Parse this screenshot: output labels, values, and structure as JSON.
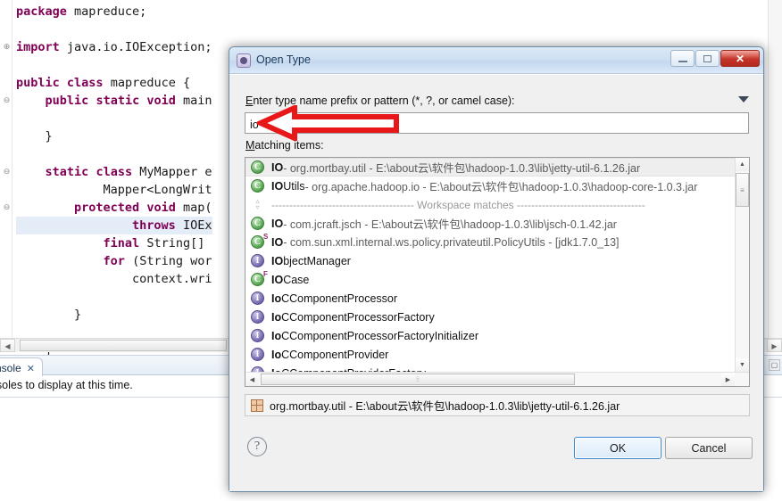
{
  "editor": {
    "lines": [
      {
        "fold": "",
        "html": "<span class=\"kw\">package</span> mapreduce;"
      },
      {
        "fold": "",
        "html": ""
      },
      {
        "fold": "+",
        "html": "<span class=\"kw\">import</span> java.io.IOException;"
      },
      {
        "fold": "",
        "html": ""
      },
      {
        "fold": "",
        "html": "<span class=\"kw\">public</span> <span class=\"kw\">class</span> mapreduce {"
      },
      {
        "fold": "-",
        "html": "    <span class=\"kw\">public</span> <span class=\"kw\">static</span> <span class=\"kw\">void</span> main"
      },
      {
        "fold": "",
        "html": ""
      },
      {
        "fold": "",
        "html": "    }"
      },
      {
        "fold": "",
        "html": ""
      },
      {
        "fold": "-",
        "html": "    <span class=\"kw\">static</span> <span class=\"kw\">class</span> MyMapper e"
      },
      {
        "fold": "",
        "html": "            Mapper&lt;LongWrit"
      },
      {
        "fold": "-",
        "html": "        <span class=\"kw\">protected</span> <span class=\"kw\">void</span> map("
      },
      {
        "fold": "",
        "html": "                <span class=\"kw\">throws</span> IOEx"
      },
      {
        "fold": "",
        "html": "            <span class=\"kw\">final</span> String[] "
      },
      {
        "fold": "",
        "html": "            <span class=\"kw\">for</span> (String wor"
      },
      {
        "fold": "",
        "html": "                context.wri"
      },
      {
        "fold": "",
        "html": ""
      },
      {
        "fold": "",
        "html": "        }"
      },
      {
        "fold": "",
        "html": ""
      },
      {
        "fold": "",
        "html": "    }"
      }
    ],
    "highlight_line_index": 12
  },
  "console": {
    "tab_label": "nsole",
    "tab_close_glyph": "✕",
    "message": "onsoles to display at this time.",
    "right_icons": [
      "minimize-icon",
      "maximize-icon"
    ]
  },
  "dialog": {
    "title": "Open Type",
    "window_buttons": {
      "minimize": "minimize-button",
      "maximize": "maximize-button",
      "close": "✕"
    },
    "prompt_label_prefix": "E",
    "prompt_label_rest": "nter type name prefix or pattern (*, ?, or camel case):",
    "search_value": "io",
    "search_placeholder": "",
    "matching_label_prefix": "M",
    "matching_label_rest": "atching items:",
    "results": [
      {
        "icon": "class-icon",
        "icon_letter": "C",
        "modifier": "",
        "name_bold": "IO",
        "name_rest": "",
        "detail": " - org.mortbay.util - E:\\about云\\软件包\\hadoop-1.0.3\\lib\\jetty-util-6.1.26.jar",
        "selected": true,
        "type": "item"
      },
      {
        "icon": "class-icon",
        "icon_letter": "C",
        "modifier": "",
        "name_bold": "IO",
        "name_rest": "Utils",
        "detail": " - org.apache.hadoop.io - E:\\about云\\软件包\\hadoop-1.0.3\\hadoop-core-1.0.3.jar",
        "selected": false,
        "type": "item"
      },
      {
        "icon": "expand-collapse-icon",
        "icon_letter": "",
        "modifier": "",
        "name_bold": "",
        "name_rest": "",
        "detail": "---------------------------------------- Workspace matches ------------------------------------",
        "selected": false,
        "type": "separator"
      },
      {
        "icon": "class-icon",
        "icon_letter": "C",
        "modifier": "",
        "name_bold": "IO",
        "name_rest": "",
        "detail": " - com.jcraft.jsch - E:\\about云\\软件包\\hadoop-1.0.3\\lib\\jsch-0.1.42.jar",
        "selected": false,
        "type": "item"
      },
      {
        "icon": "class-icon",
        "icon_letter": "C",
        "modifier": "S",
        "name_bold": "IO",
        "name_rest": "",
        "detail": " - com.sun.xml.internal.ws.policy.privateutil.PolicyUtils - [jdk1.7.0_13]",
        "selected": false,
        "type": "item"
      },
      {
        "icon": "interface-icon",
        "icon_letter": "I",
        "modifier": "",
        "name_bold": "IO",
        "name_rest": "bjectManager",
        "detail": "",
        "selected": false,
        "type": "item"
      },
      {
        "icon": "class-icon",
        "icon_letter": "C",
        "modifier": "F",
        "name_bold": "IO",
        "name_rest": "Case",
        "detail": "",
        "selected": false,
        "type": "item"
      },
      {
        "icon": "interface-icon",
        "icon_letter": "I",
        "modifier": "",
        "name_bold": "Io",
        "name_rest": "CComponentProcessor",
        "detail": "",
        "selected": false,
        "type": "item"
      },
      {
        "icon": "interface-icon",
        "icon_letter": "I",
        "modifier": "",
        "name_bold": "Io",
        "name_rest": "CComponentProcessorFactory",
        "detail": "",
        "selected": false,
        "type": "item"
      },
      {
        "icon": "interface-icon",
        "icon_letter": "I",
        "modifier": "",
        "name_bold": "Io",
        "name_rest": "CComponentProcessorFactoryInitializer",
        "detail": "",
        "selected": false,
        "type": "item"
      },
      {
        "icon": "interface-icon",
        "icon_letter": "I",
        "modifier": "",
        "name_bold": "Io",
        "name_rest": "CComponentProvider",
        "detail": "",
        "selected": false,
        "type": "item"
      },
      {
        "icon": "interface-icon",
        "icon_letter": "I",
        "modifier": "",
        "name_bold": "Io",
        "name_rest": "CComponentProviderFactory",
        "detail": "",
        "selected": false,
        "type": "item"
      }
    ],
    "status_text": "org.mortbay.util - E:\\about云\\软件包\\hadoop-1.0.3\\lib\\jetty-util-6.1.26.jar",
    "help_glyph": "?",
    "ok_label": "OK",
    "cancel_label": "Cancel",
    "scroll": {
      "up_glyph": "▲",
      "down_glyph": "▼",
      "left_glyph": "◀",
      "right_glyph": "▶",
      "thumb_grip": "≡",
      "h_thumb_grip": "⦙⦙"
    }
  },
  "annotation": {
    "arrow_color": "#e8171a",
    "arrow_direction": "left"
  }
}
